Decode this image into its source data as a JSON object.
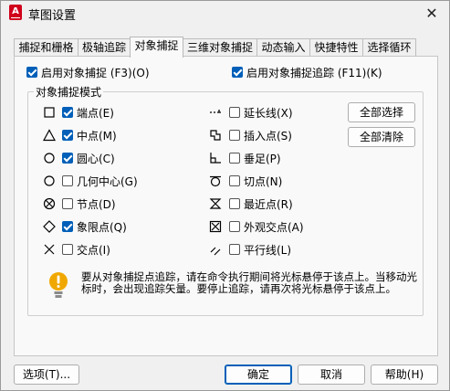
{
  "window": {
    "title": "草图设置",
    "app_icon": "A",
    "close": "✕"
  },
  "tabs": [
    "捕捉和栅格",
    "极轴追踪",
    "对象捕捉",
    "三维对象捕捉",
    "动态输入",
    "快捷特性",
    "选择循环"
  ],
  "top": {
    "osnap_on": {
      "label": "启用对象捕捉 (F3)(O)",
      "checked": true
    },
    "otrack_on": {
      "label": "启用对象捕捉追踪 (F11)(K)",
      "checked": true
    }
  },
  "modes": {
    "title": "对象捕捉模式",
    "left": [
      {
        "icon": "endpoint-square-icon",
        "label": "端点(E)",
        "checked": true
      },
      {
        "icon": "midpoint-triangle-icon",
        "label": "中点(M)",
        "checked": true
      },
      {
        "icon": "center-circle-icon",
        "label": "圆心(C)",
        "checked": true
      },
      {
        "icon": "geometric-center-icon",
        "label": "几何中心(G)",
        "checked": false
      },
      {
        "icon": "node-icon",
        "label": "节点(D)",
        "checked": false
      },
      {
        "icon": "quadrant-diamond-icon",
        "label": "象限点(Q)",
        "checked": true
      },
      {
        "icon": "intersection-x-icon",
        "label": "交点(I)",
        "checked": false
      }
    ],
    "right": [
      {
        "icon": "extension-icon",
        "label": "延长线(X)",
        "checked": false
      },
      {
        "icon": "insertion-icon",
        "label": "插入点(S)",
        "checked": false
      },
      {
        "icon": "perpendicular-icon",
        "label": "垂足(P)",
        "checked": false
      },
      {
        "icon": "tangent-icon",
        "label": "切点(N)",
        "checked": false
      },
      {
        "icon": "nearest-icon",
        "label": "最近点(R)",
        "checked": false
      },
      {
        "icon": "apparent-intersection-icon",
        "label": "外观交点(A)",
        "checked": false
      },
      {
        "icon": "parallel-icon",
        "label": "平行线(L)",
        "checked": false
      }
    ],
    "select_all": "全部选择",
    "clear_all": "全部清除"
  },
  "note": "要从对象捕捉点追踪，请在命令执行期间将光标悬停于该点上。当移动光标时，会出现追踪矢量。要停止追踪，请再次将光标悬停于该点上。",
  "footer": {
    "options": "选项(T)...",
    "ok": "确定",
    "cancel": "取消",
    "help": "帮助(H)"
  },
  "colors": {
    "accent": "#005fb8",
    "warning": "#f0a800",
    "app_icon": "#d0021b"
  }
}
